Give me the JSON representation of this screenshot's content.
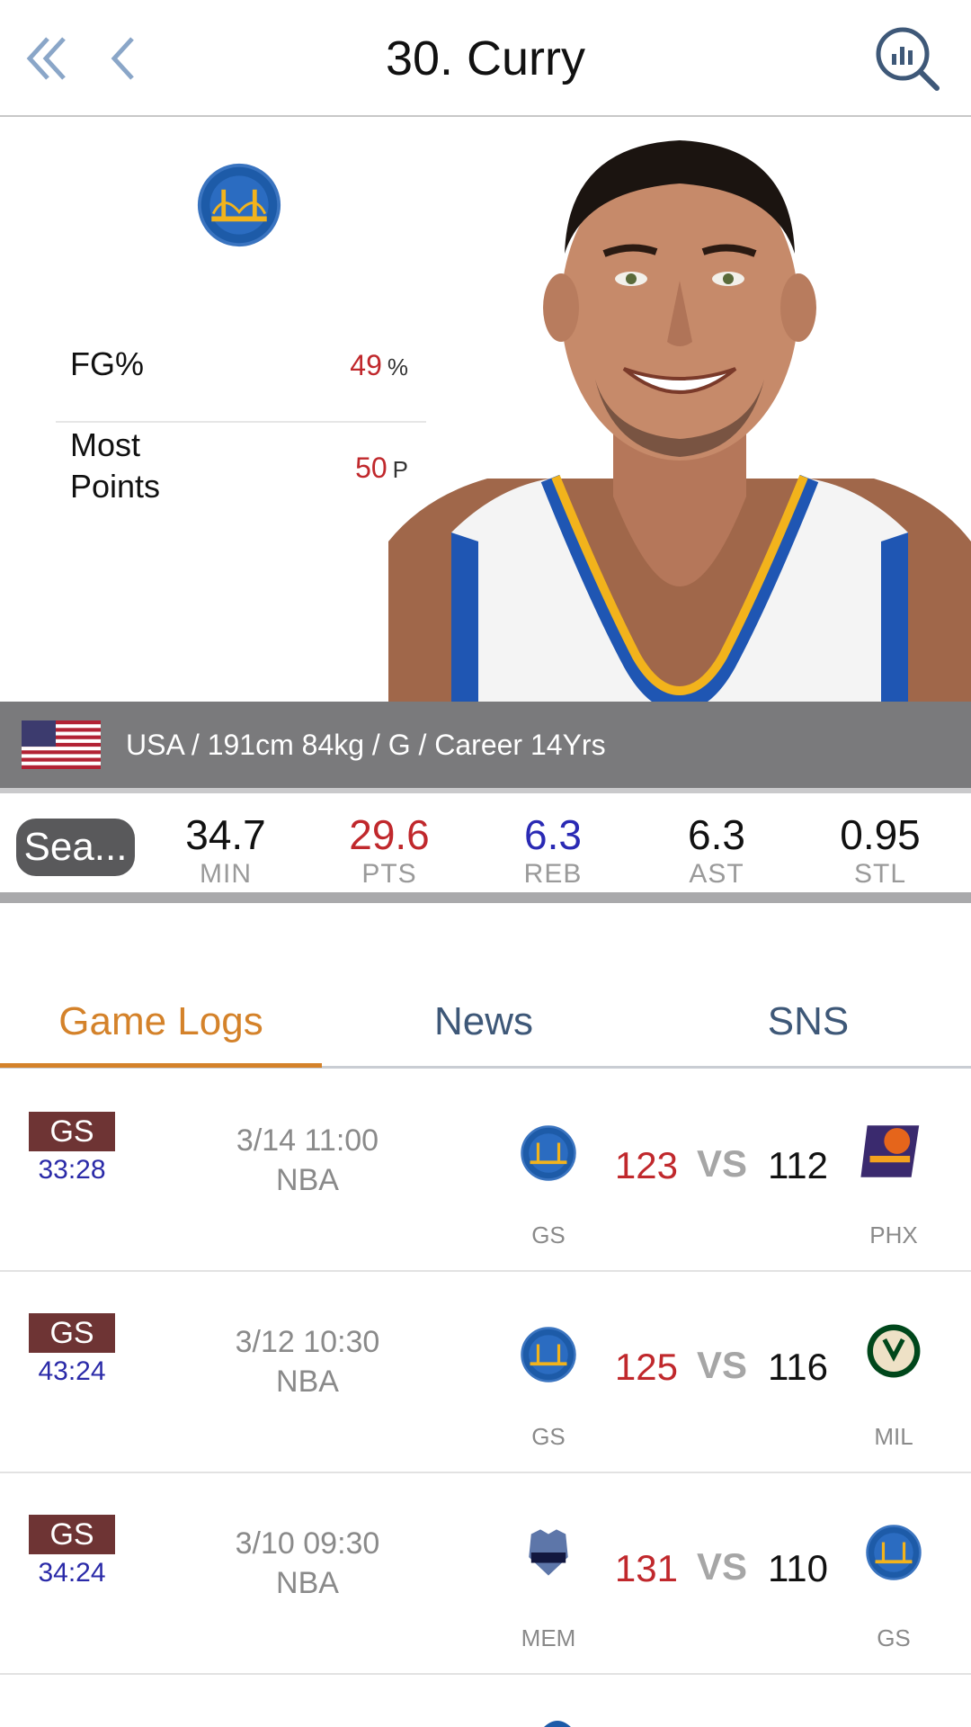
{
  "header": {
    "title": "30. Curry"
  },
  "player": {
    "team_logo": "warriors-logo",
    "stats": [
      {
        "label": "FG%",
        "value": "49",
        "unit": "%"
      },
      {
        "label": "Most\nPoints",
        "value": "50",
        "unit": "P"
      }
    ],
    "info": "USA / 191cm 84kg / G / Career 14Yrs",
    "flag": "usa-flag"
  },
  "season": {
    "button_label": "Sea...",
    "stats": [
      {
        "value": "34.7",
        "key": "MIN",
        "color": "#111111"
      },
      {
        "value": "29.6",
        "key": "PTS",
        "color": "#c0282c"
      },
      {
        "value": "6.3",
        "key": "REB",
        "color": "#2a2ab4"
      },
      {
        "value": "6.3",
        "key": "AST",
        "color": "#111111"
      },
      {
        "value": "0.95",
        "key": "STL",
        "color": "#111111"
      }
    ]
  },
  "tabs": [
    {
      "label": "Game Logs",
      "active": true
    },
    {
      "label": "News",
      "active": false
    },
    {
      "label": "SNS",
      "active": false
    }
  ],
  "games": [
    {
      "team": "GS",
      "minutes": "33:28",
      "date": "3/14 11:00",
      "league": "NBA",
      "home_abbr": "GS",
      "home_logo": "warriors-logo",
      "home_score": "123",
      "vs": "VS",
      "away_score": "112",
      "away_abbr": "PHX",
      "away_logo": "suns-logo"
    },
    {
      "team": "GS",
      "minutes": "43:24",
      "date": "3/12 10:30",
      "league": "NBA",
      "home_abbr": "GS",
      "home_logo": "warriors-logo",
      "home_score": "125",
      "vs": "VS",
      "away_score": "116",
      "away_abbr": "MIL",
      "away_logo": "bucks-logo"
    },
    {
      "team": "GS",
      "minutes": "34:24",
      "date": "3/10 09:30",
      "league": "NBA",
      "home_abbr": "MEM",
      "home_logo": "grizzlies-logo",
      "home_score": "131",
      "vs": "VS",
      "away_score": "110",
      "away_abbr": "GS",
      "away_logo": "warriors-logo"
    }
  ],
  "colors": {
    "accent": "#d4822a",
    "tab_inactive": "#3e5878",
    "win_score": "#c0282c",
    "minutes": "#2a2aa8",
    "team_badge": "#6e3434"
  }
}
